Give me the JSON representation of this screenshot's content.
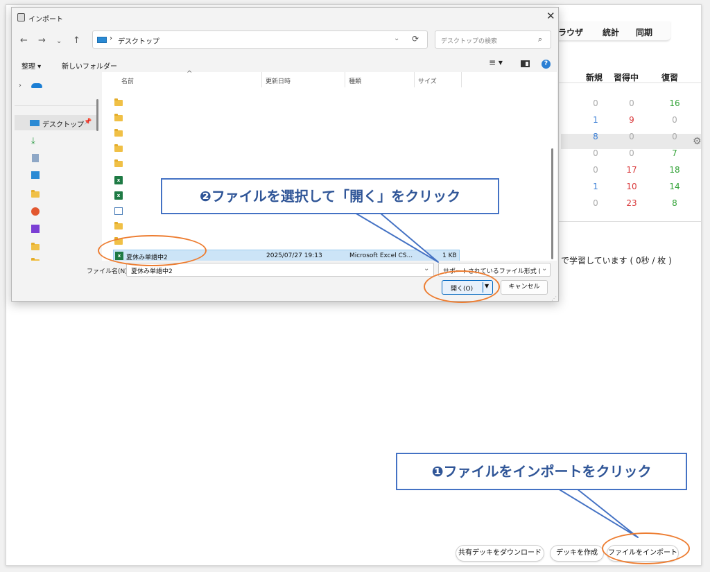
{
  "anki": {
    "nav": {
      "browse_partial": "ラウザ",
      "stats": "統計",
      "sync": "同期"
    },
    "columns": {
      "new": "新規",
      "learning": "習得中",
      "review": "復習"
    },
    "rows": [
      {
        "new": "0",
        "learning": "0",
        "review": "16"
      },
      {
        "new": "1",
        "learning": "9",
        "review": "0"
      },
      {
        "new": "8",
        "learning": "0",
        "review": "0"
      },
      {
        "new": "0",
        "learning": "0",
        "review": "7"
      },
      {
        "new": "0",
        "learning": "17",
        "review": "18"
      },
      {
        "new": "1",
        "learning": "10",
        "review": "14"
      },
      {
        "new": "0",
        "learning": "23",
        "review": "8"
      }
    ],
    "study_text": "で学習しています ( 0秒 / 枚 )",
    "buttons": {
      "download": "共有デッキをダウンロード",
      "create": "デッキを作成",
      "import": "ファイルをインポート"
    }
  },
  "dialog": {
    "title": "インポート",
    "breadcrumb": "デスクトップ",
    "search_placeholder": "デスクトップの検索",
    "toolbar": {
      "organize": "整理 ▾",
      "new_folder": "新しいフォルダー"
    },
    "nav": {
      "desktop": "デスクトップ"
    },
    "columns": {
      "name": "名前",
      "modified": "更新日時",
      "type": "種類",
      "size": "サイズ"
    },
    "selected_file": {
      "name": "夏休み単語中2",
      "modified": "2025/07/27 19:13",
      "type": "Microsoft Excel CS...",
      "size": "1 KB"
    },
    "filename_label": "ファイル名(N):",
    "filename_value": "夏休み単語中2",
    "filetype": "サポートされているファイル形式 (*.tx",
    "open_label": "開く(O)",
    "cancel_label": "キャンセル"
  },
  "callouts": {
    "step1": "❶ファイルをインポートをクリック",
    "step2": "❷ファイルを選択して「開く」をクリック"
  },
  "colors": {
    "callout_border": "#4472c4",
    "callout_text": "#2f5597",
    "highlight_ring": "#ed7d31",
    "selection": "#cce4f7"
  }
}
